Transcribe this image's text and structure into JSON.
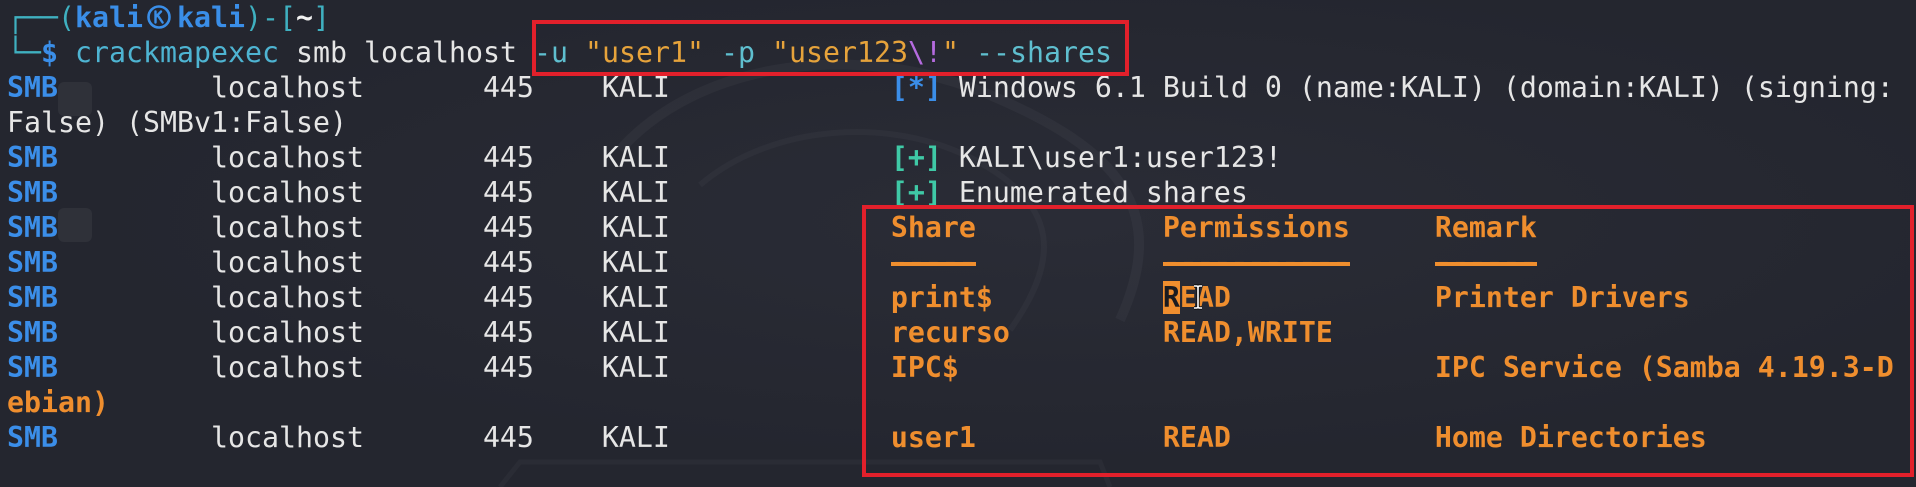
{
  "colors": {
    "background": "#24262f",
    "prompt_frame": "#3fb0c0",
    "prompt_user": "#3a8ee8",
    "prompt_dir": "#f2f2f2",
    "command": "#4eb4d2",
    "option": "#5fbfcf",
    "string": "#e6a33b",
    "escape": "#b56be0",
    "output_text": "#e6e6e6",
    "proto": "#3b8ee9",
    "info_tag": "#3b8ee9",
    "success_tag": "#3fc9a6",
    "share_table": "#ef8e2e",
    "annotation": "#e2202b"
  },
  "icons": {
    "prompt_separator": "kali-at-symbol-icon",
    "pointer": "text-cursor-icon"
  },
  "prompt": {
    "frame_top": "┌──(",
    "user": "kali",
    "at": "㉿",
    "host": "kali",
    "dir_open": ")-[",
    "dir": "~",
    "dir_close": "]",
    "frame_bottom": "└─",
    "symbol": "$"
  },
  "command": {
    "program": "crackmapexec",
    "protocol": "smb",
    "target": "localhost",
    "user_flag": "-u",
    "user_value": "\"user1\"",
    "password_flag": "-p",
    "password_value_open": "\"user123",
    "password_escape": "\\!",
    "password_value_close": "\"",
    "shares_flag": "--shares"
  },
  "output": {
    "info": {
      "proto": "SMB",
      "host": "localhost",
      "port": "445",
      "name": "KALI",
      "tag": "[*]",
      "text": "Windows 6.1 Build 0 (name:KALI) (domain:KALI) (signing:",
      "text_wrap": "False) (SMBv1:False)"
    },
    "auth": {
      "proto": "SMB",
      "host": "localhost",
      "port": "445",
      "name": "KALI",
      "tag": "[+]",
      "text": "KALI\\user1:user123!"
    },
    "enum": {
      "proto": "SMB",
      "host": "localhost",
      "port": "445",
      "name": "KALI",
      "tag": "[+]",
      "text": "Enumerated shares"
    },
    "share_table": {
      "header_row": {
        "proto": "SMB",
        "host": "localhost",
        "port": "445",
        "name": "KALI"
      },
      "columns": {
        "share": "Share",
        "permissions": "Permissions",
        "remark": "Remark"
      },
      "rule_row": {
        "proto": "SMB",
        "host": "localhost",
        "port": "445",
        "name": "KALI"
      },
      "rules": {
        "share": "-----",
        "permissions": "-----------",
        "remark": "------"
      },
      "rows": [
        {
          "proto": "SMB",
          "host": "localhost",
          "port": "445",
          "name": "KALI",
          "share": "print$",
          "permissions": "READ",
          "remark": "Printer Drivers"
        },
        {
          "proto": "SMB",
          "host": "localhost",
          "port": "445",
          "name": "KALI",
          "share": "recurso",
          "permissions": "READ,WRITE"
        },
        {
          "proto": "SMB",
          "host": "localhost",
          "port": "445",
          "name": "KALI",
          "share": "IPC$",
          "remark": "IPC Service (Samba 4.19.3-D",
          "remark_wrap": "ebian)"
        },
        {
          "proto": "SMB",
          "host": "localhost",
          "port": "445",
          "name": "KALI",
          "share": "user1",
          "permissions": "READ",
          "remark": "Home Directories"
        }
      ]
    }
  }
}
